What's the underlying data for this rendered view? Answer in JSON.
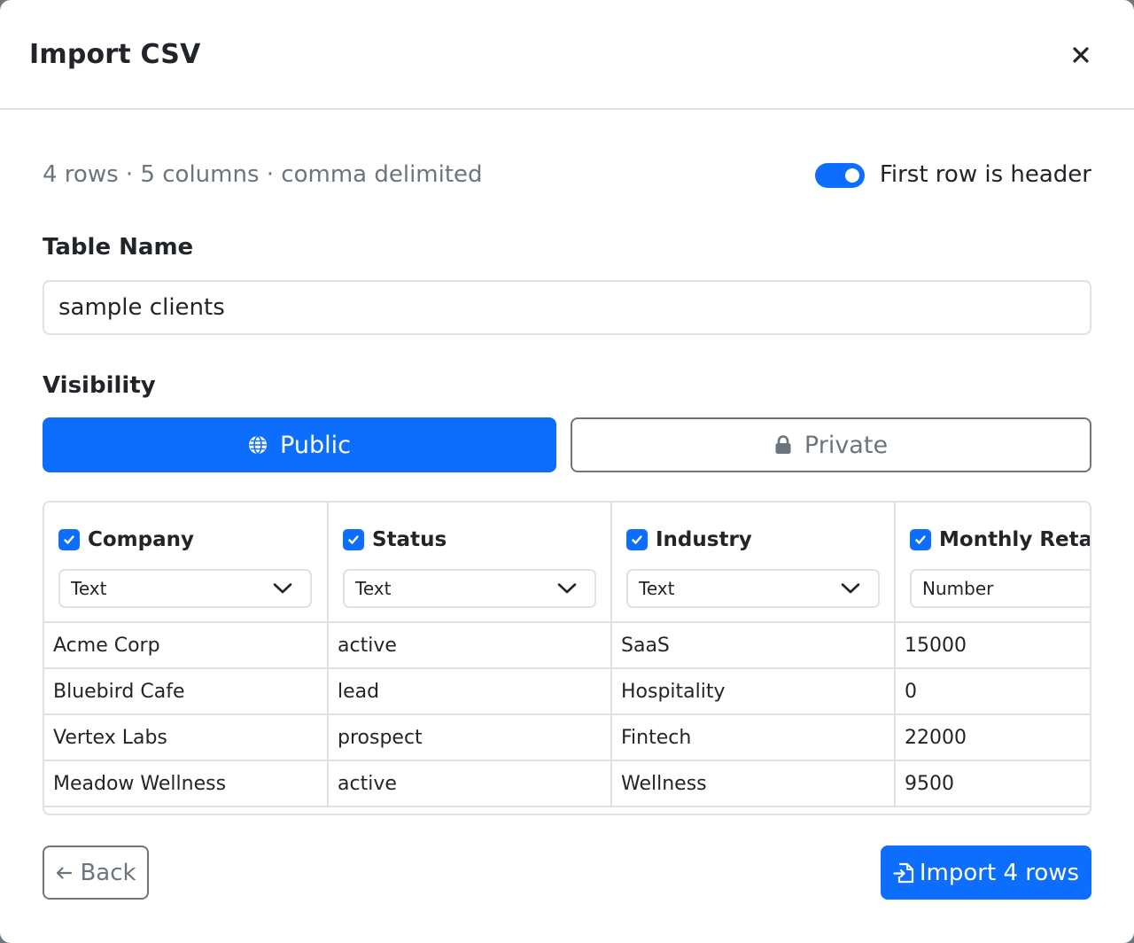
{
  "modal": {
    "title": "Import CSV",
    "close_label": "×"
  },
  "summary": "4 rows · 5 columns · comma delimited",
  "header_toggle": {
    "label": "First row is header",
    "checked": true
  },
  "table_name": {
    "label": "Table Name",
    "value": "sample clients"
  },
  "visibility": {
    "label": "Visibility",
    "options": [
      {
        "label": "Public",
        "icon": "globe-icon",
        "selected": true
      },
      {
        "label": "Private",
        "icon": "lock-icon",
        "selected": false
      }
    ]
  },
  "columns": [
    {
      "name": "Company",
      "type": "Text",
      "checked": true
    },
    {
      "name": "Status",
      "type": "Text",
      "checked": true
    },
    {
      "name": "Industry",
      "type": "Text",
      "checked": true
    },
    {
      "name": "Monthly Retaine",
      "type": "Number",
      "checked": true
    }
  ],
  "rows": [
    [
      "Acme Corp",
      "active",
      "SaaS",
      "15000"
    ],
    [
      "Bluebird Cafe",
      "lead",
      "Hospitality",
      "0"
    ],
    [
      "Vertex Labs",
      "prospect",
      "Fintech",
      "22000"
    ],
    [
      "Meadow Wellness",
      "active",
      "Wellness",
      "9500"
    ]
  ],
  "footer": {
    "back_label": "Back",
    "import_label": "Import 4 rows"
  },
  "colors": {
    "primary": "#0d6efd",
    "secondary": "#6c757d",
    "border": "#dee2e6"
  }
}
